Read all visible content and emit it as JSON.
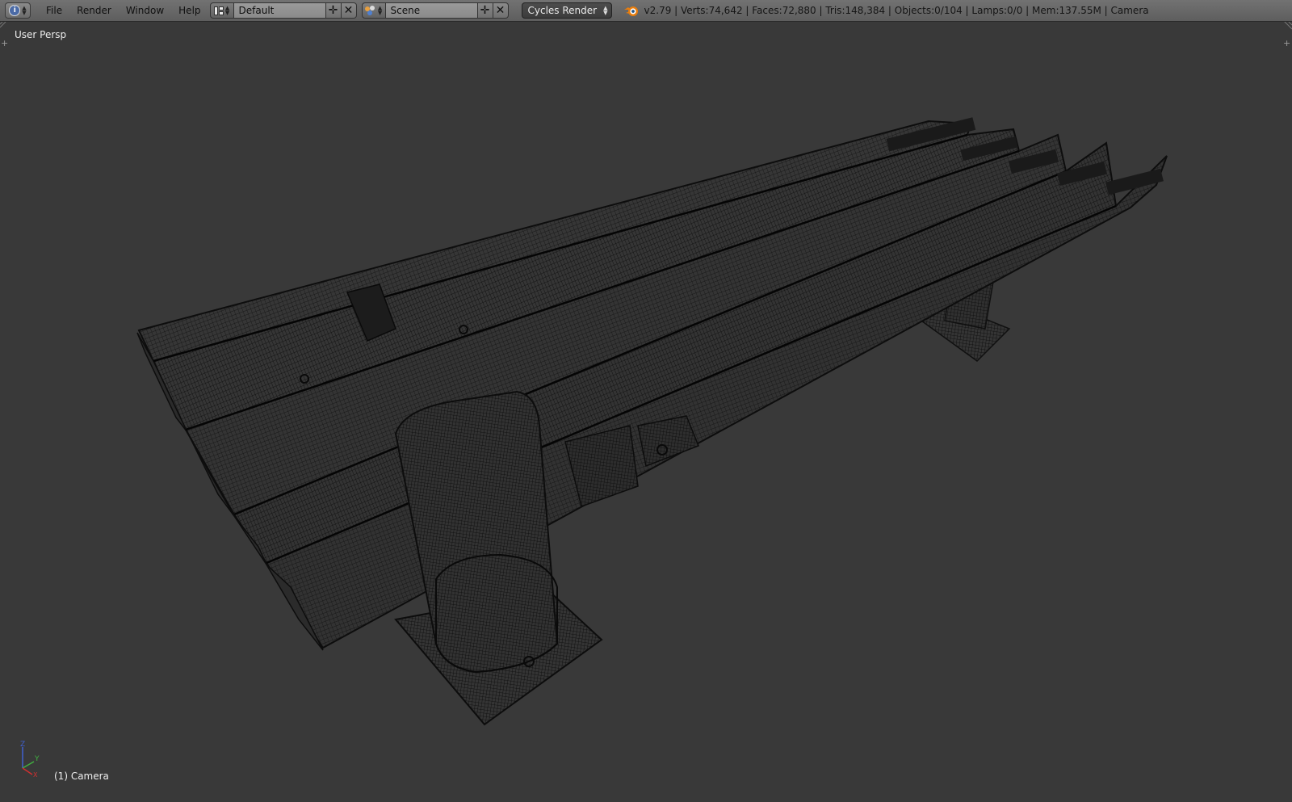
{
  "header": {
    "editor_type_icon": "info-icon",
    "menus": [
      "File",
      "Render",
      "Window",
      "Help"
    ],
    "screen_layout": {
      "icon": "screen-layout-icon",
      "value": "Default"
    },
    "scene": {
      "icon": "scene-icon",
      "value": "Scene"
    },
    "render_engine": "Cycles Render",
    "logo_icon": "blender-logo-icon",
    "stats": "v2.79 | Verts:74,642 | Faces:72,880 | Tris:148,384 | Objects:0/104 | Lamps:0/0 | Mem:137.55M | Camera"
  },
  "viewport": {
    "view_name": "User Persp",
    "active_object": "(1) Camera",
    "axis_labels": {
      "x": "X",
      "y": "Y",
      "z": "Z"
    },
    "colors": {
      "background": "#393939",
      "wire": "#000000",
      "axis_x": "#d03030",
      "axis_y": "#40b040",
      "axis_z": "#4060d0"
    }
  }
}
